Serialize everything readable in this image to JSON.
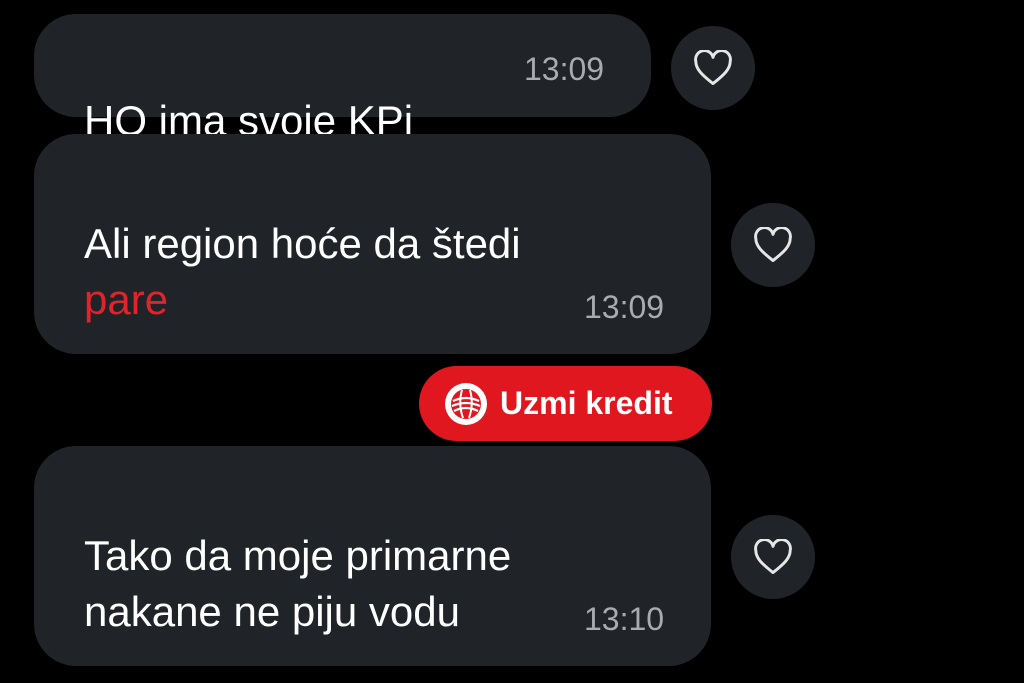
{
  "messages": [
    {
      "text": "HQ ima svoje KPi",
      "highlight": "",
      "time": "13:09"
    },
    {
      "text": "Ali region hoće da štedi",
      "highlight": "pare",
      "time": "13:09"
    },
    {
      "text": "Tako da moje primarne\nnakane ne piju vodu",
      "highlight": "",
      "time": "13:10"
    }
  ],
  "promo": {
    "label": "Uzmi kredit",
    "logo_icon": "bank-globe-logo-icon",
    "color": "#e0171f"
  },
  "colors": {
    "background": "#000000",
    "bubble": "#202328",
    "text": "#ffffff",
    "time": "#a9abaf",
    "highlight": "#e0242a"
  },
  "icons": {
    "reaction": "heart-outline-icon"
  }
}
